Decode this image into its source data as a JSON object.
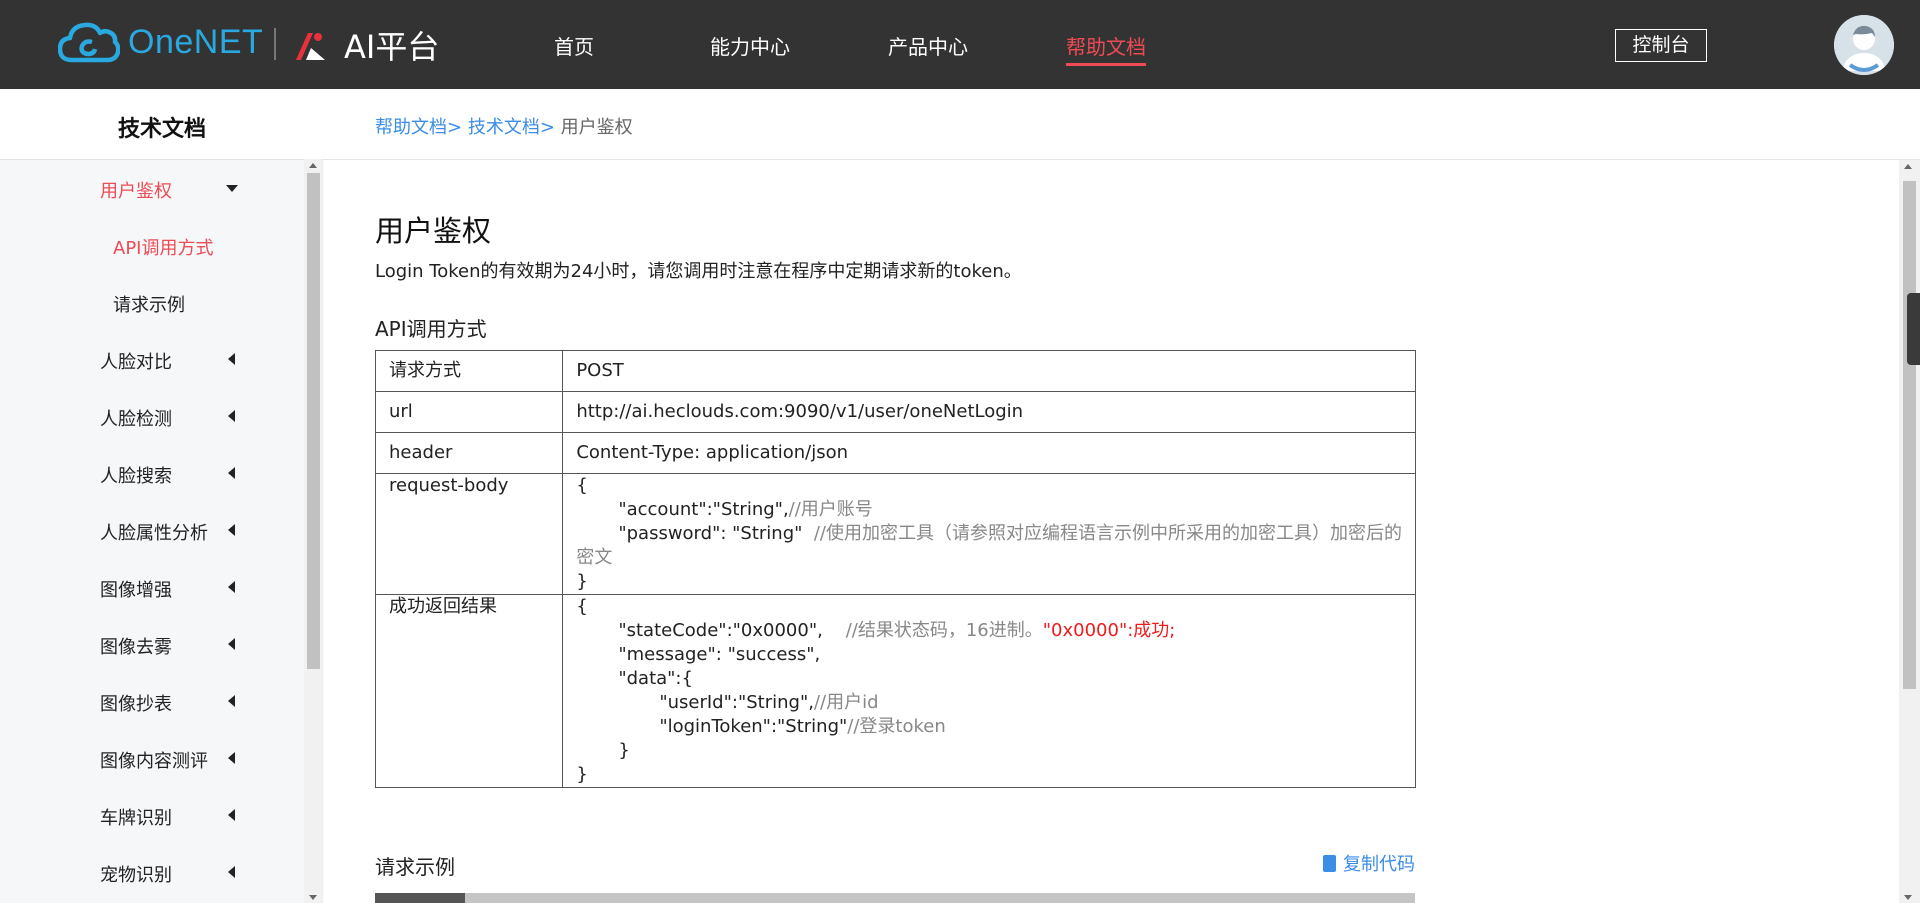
{
  "header": {
    "logo_text": "OneNET",
    "platform_name": "AI平台",
    "nav": [
      {
        "label": "首页",
        "active": false
      },
      {
        "label": "能力中心",
        "active": false
      },
      {
        "label": "产品中心",
        "active": false
      },
      {
        "label": "帮助文档",
        "active": true
      }
    ],
    "console_label": "控制台",
    "accent_color": "#ee4b55"
  },
  "sidebar": {
    "title": "技术文档",
    "items": [
      {
        "label": "用户鉴权",
        "active": true,
        "expanded": true
      },
      {
        "label": "API调用方式",
        "active": true,
        "sub": true
      },
      {
        "label": "请求示例",
        "active": false,
        "sub": true
      },
      {
        "label": "人脸对比",
        "active": false
      },
      {
        "label": "人脸检测",
        "active": false
      },
      {
        "label": "人脸搜索",
        "active": false
      },
      {
        "label": "人脸属性分析",
        "active": false
      },
      {
        "label": "图像增强",
        "active": false
      },
      {
        "label": "图像去雾",
        "active": false
      },
      {
        "label": "图像抄表",
        "active": false
      },
      {
        "label": "图像内容测评",
        "active": false
      },
      {
        "label": "车牌识别",
        "active": false
      },
      {
        "label": "宠物识别",
        "active": false
      }
    ]
  },
  "breadcrumb": {
    "items": [
      "帮助文档>",
      "技术文档>"
    ],
    "current": "用户鉴权"
  },
  "main": {
    "title": "用户鉴权",
    "description": "Login Token的有效期为24小时，请您调用时注意在程序中定期请求新的token。",
    "section_api": "API调用方式",
    "table": {
      "method_key": "请求方式",
      "method_val": "POST",
      "url_key": "url",
      "url_val": "http://ai.heclouds.com:9090/v1/user/oneNetLogin",
      "header_key": "header",
      "header_val": "Content-Type: application/json",
      "body_key": "request-body",
      "body": {
        "open": "{",
        "l1_code": "\"account\":\"String\",",
        "l1_comment": "//用户账号",
        "l2_code": "\"password\": \"String\"",
        "l2_comment": "//使用加密工具（请参照对应编程语言示例中所采用的加密工具）加密后的",
        "l2_comment_wrap": "密文",
        "close": "}"
      },
      "result_key": "成功返回结果",
      "result": {
        "open": "{",
        "l1_code": "\"stateCode\":\"0x0000\",",
        "l1_comment": "//结果状态码，16进制。",
        "l1_red": "\"0x0000\":成功;",
        "l2_code": "\"message\": \"success\",",
        "l3_code": "\"data\":{",
        "l4_code": "\"userId\":\"String\",",
        "l4_comment": "//用户id",
        "l5_code": "\"loginToken\":\"String\"",
        "l5_comment": "//登录token",
        "l6_code": "}",
        "close": "}"
      }
    },
    "section_example": "请求示例",
    "copy_label": "复制代码"
  }
}
